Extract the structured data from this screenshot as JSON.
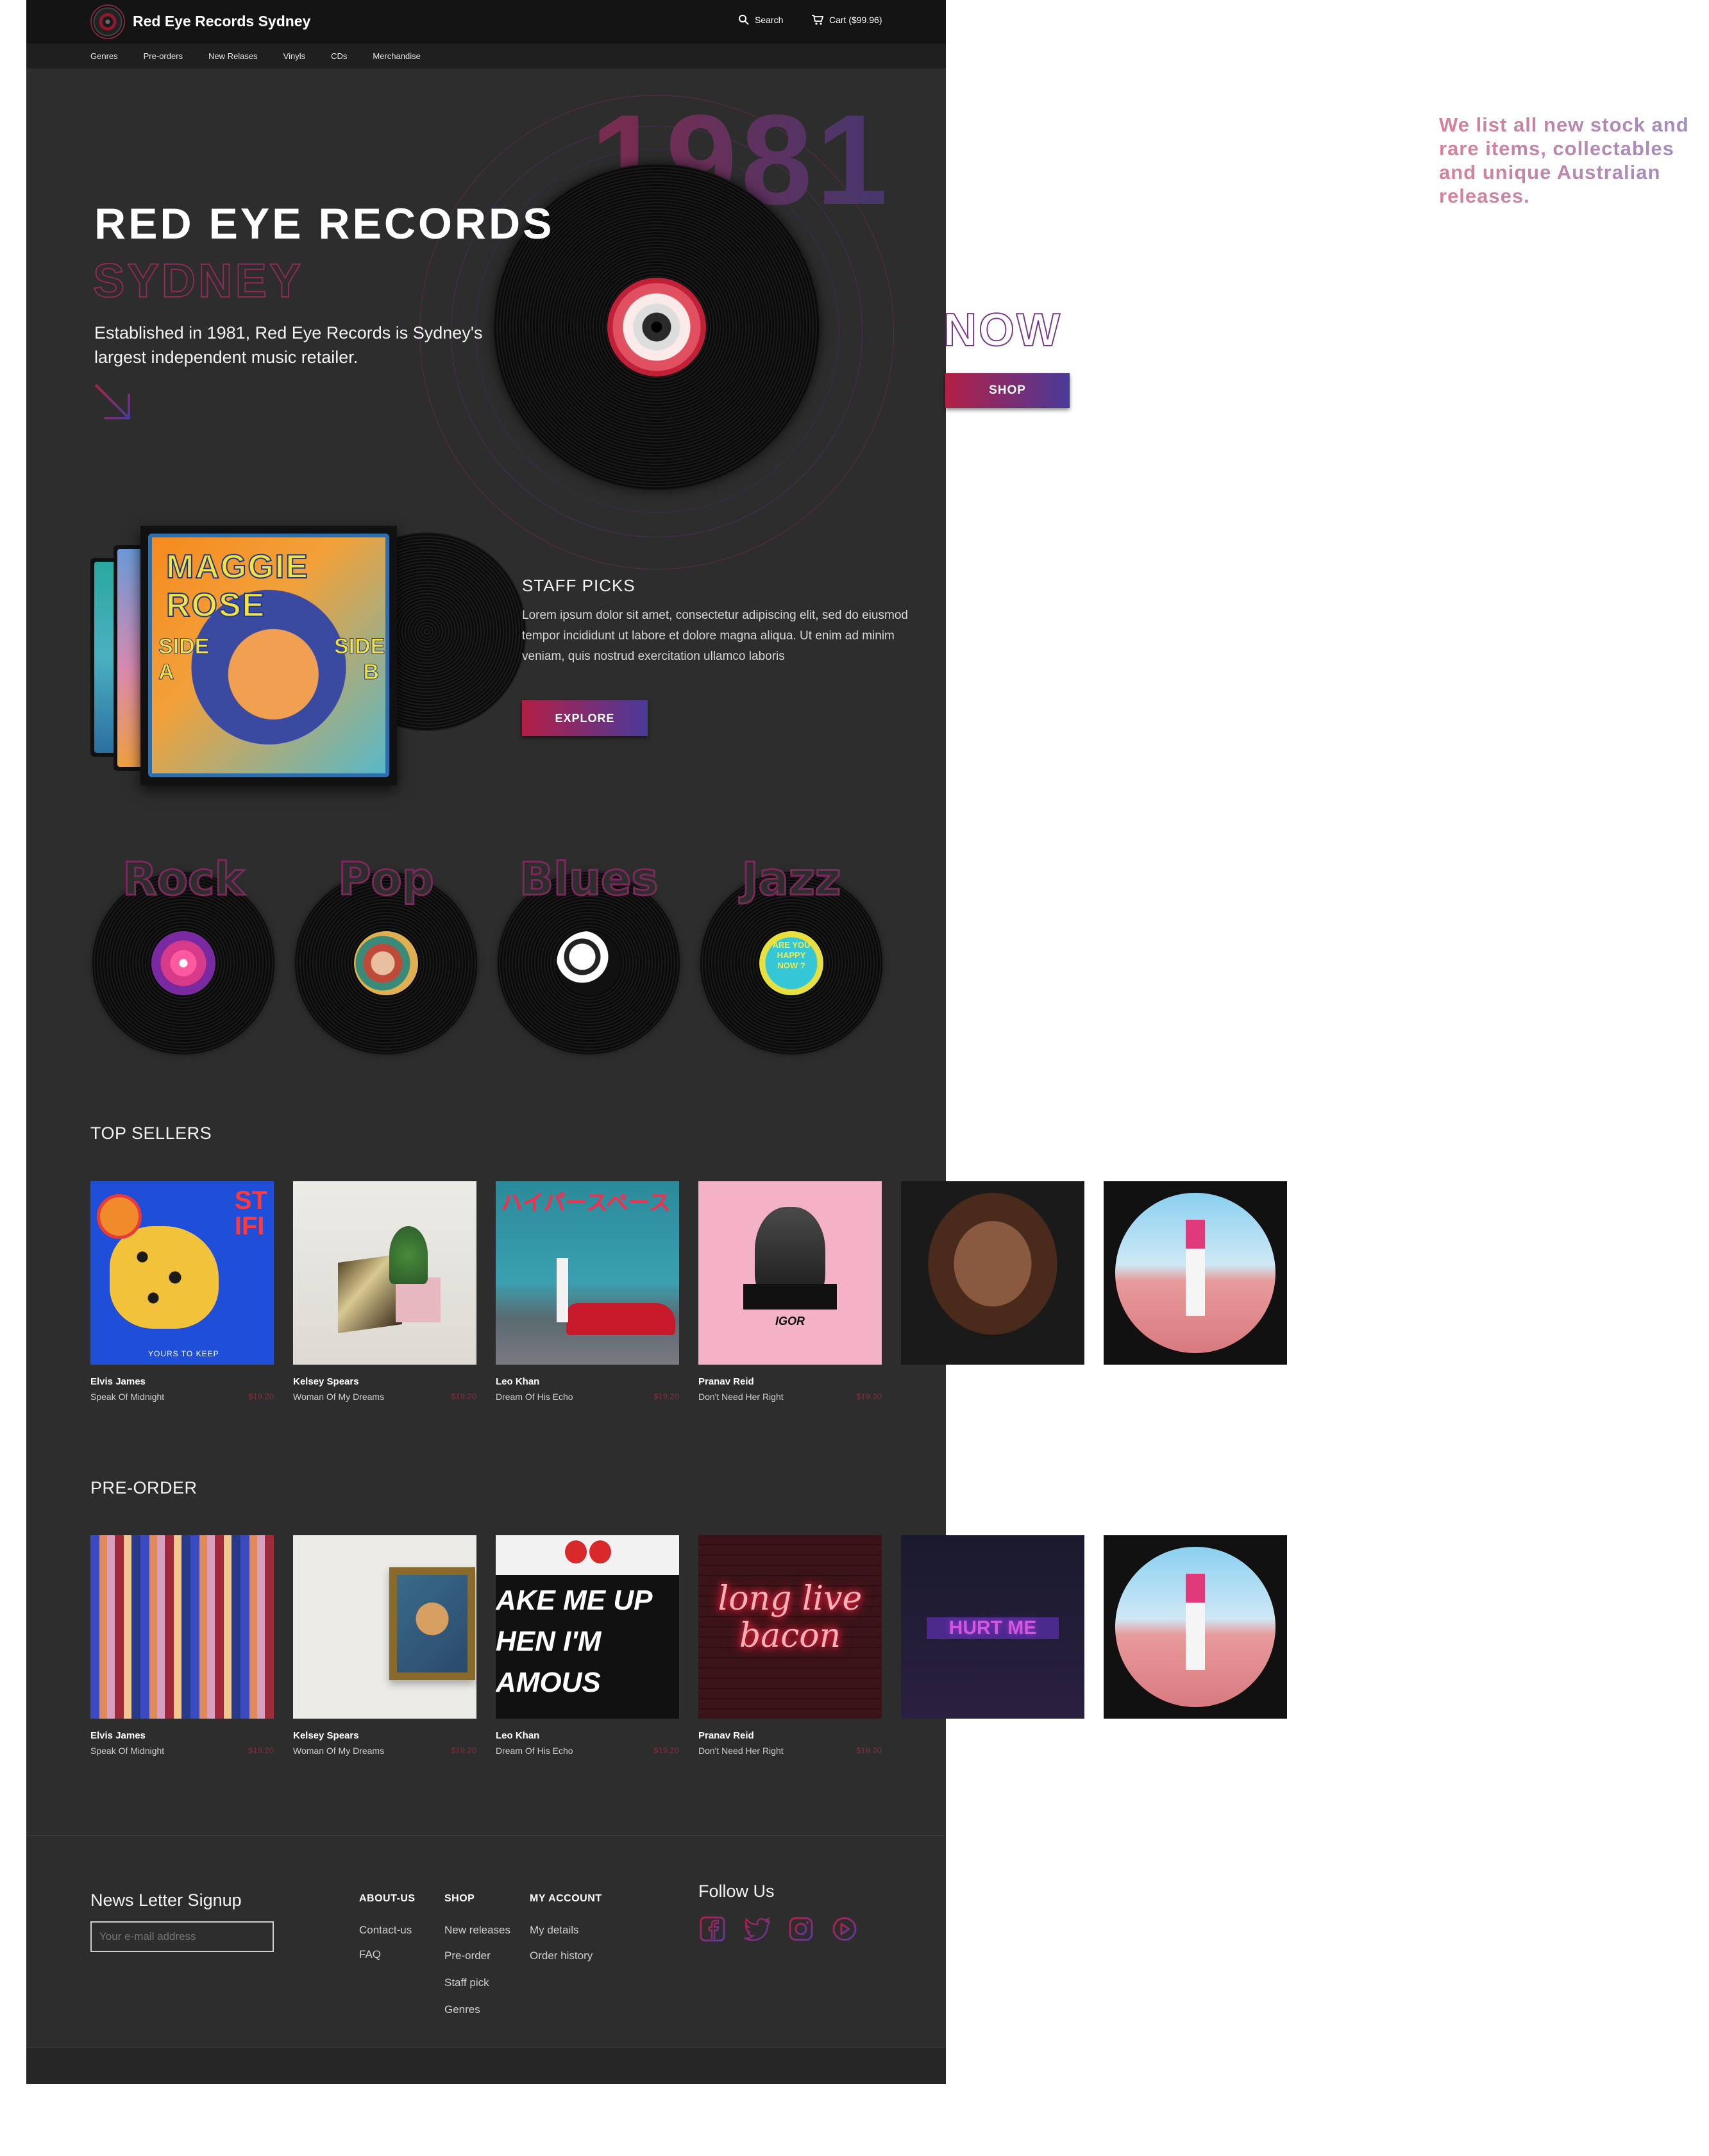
{
  "header": {
    "brand": "Red Eye Records Sydney",
    "search_label": "Search",
    "cart_label": "Cart ($99.96)"
  },
  "nav": {
    "items": [
      "Genres",
      "Pre-orders",
      "New Relases",
      "Vinyls",
      "CDs",
      "Merchandise"
    ]
  },
  "hero": {
    "title": "RED EYE RECORDS",
    "subtitle": "SYDNEY",
    "description": "Established in 1981, Red Eye Records is Sydney's largest independent music retailer.",
    "year": "1981"
  },
  "side_panel": {
    "note": "We list all new stock and rare items, collectables and unique Australian releases.",
    "now_text": "NOW",
    "shop_button": "SHOP"
  },
  "staff_picks": {
    "heading": "STAFF PICKS",
    "text": "Lorem ipsum dolor sit amet, consectetur adipiscing elit, sed do eiusmod tempor incididunt ut labore et dolore magna aliqua. Ut enim ad minim veniam, quis nostrud exercitation ullamco laboris",
    "button": "EXPLORE",
    "cover_title": "MAGGIE ROSE",
    "cover_side_left": "SIDE A",
    "cover_side_right": "SIDE B"
  },
  "genres": [
    {
      "name": "Rock"
    },
    {
      "name": "Pop"
    },
    {
      "name": "Blues"
    },
    {
      "name": "Jazz"
    }
  ],
  "jazz_label_text": "ARE YOU HAPPY NOW ?",
  "top_sellers": {
    "title": "TOP SELLERS",
    "items": [
      {
        "artist": "Elvis James",
        "album": "Speak Of Midnight",
        "price": "$19.20",
        "cover_text": "YOURS TO KEEP"
      },
      {
        "artist": "Kelsey Spears",
        "album": "Woman Of My Dreams",
        "price": "$19.20"
      },
      {
        "artist": "Leo Khan",
        "album": "Dream Of His Echo",
        "price": "$19.20",
        "cover_text": "ハイパースペース"
      },
      {
        "artist": "Pranav Reid",
        "album": "Don't Need Her Right",
        "price": "$19.20",
        "cover_text": "IGOR"
      }
    ]
  },
  "pre_order": {
    "title": "PRE-ORDER",
    "items": [
      {
        "artist": "Elvis James",
        "album": "Speak Of Midnight",
        "price": "$19.20"
      },
      {
        "artist": "Kelsey Spears",
        "album": "Woman Of My Dreams",
        "price": "$19.20"
      },
      {
        "artist": "Leo Khan",
        "album": "Dream Of His Echo",
        "price": "$19.20",
        "cover_lines": [
          "AKE ME UP",
          "HEN I'M",
          "AMOUS"
        ]
      },
      {
        "artist": "Pranav Reid",
        "album": "Don't Need Her Right",
        "price": "$19.20",
        "cover_text": "long live bacon"
      }
    ],
    "extra_cover_text": "HURT ME"
  },
  "footer": {
    "newsletter_title": "News Letter Signup",
    "email_placeholder": "Your e-mail address",
    "columns": [
      {
        "title": "ABOUT-US",
        "links": [
          "Contact-us",
          "FAQ"
        ]
      },
      {
        "title": "SHOP",
        "links": [
          "New releases",
          "Pre-order",
          "Staff pick",
          "Genres"
        ]
      },
      {
        "title": "MY ACCOUNT",
        "links": [
          "My details",
          "Order history"
        ]
      }
    ],
    "follow_title": "Follow Us",
    "social": [
      "facebook-icon",
      "twitter-icon",
      "instagram-icon",
      "youtube-icon"
    ]
  },
  "colors": {
    "accent_red": "#b31f45",
    "accent_purple": "#4a3a9a",
    "page_bg": "#2d2d2d",
    "topbar_bg": "#141414"
  }
}
